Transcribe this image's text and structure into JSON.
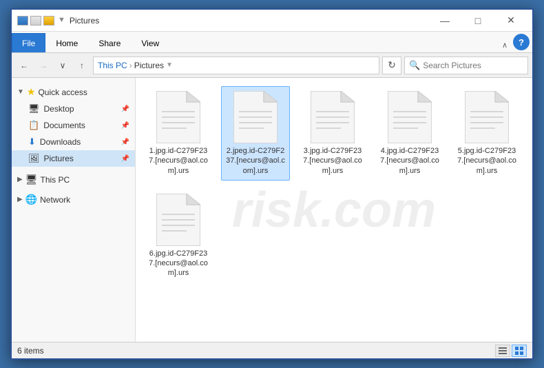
{
  "window": {
    "title": "Pictures",
    "icon_label": "folder-icon"
  },
  "ribbon": {
    "tabs": [
      "File",
      "Home",
      "Share",
      "View"
    ],
    "active_tab": "File",
    "expand_label": "∧",
    "help_label": "?"
  },
  "address_bar": {
    "back_label": "←",
    "forward_label": "→",
    "dropdown_label": "∨",
    "up_label": "↑",
    "breadcrumb": {
      "thispc": "This PC",
      "separator": "›",
      "current": "Pictures"
    },
    "refresh_label": "↻",
    "search_placeholder": "Search Pictures"
  },
  "sidebar": {
    "quick_access_label": "Quick access",
    "items": [
      {
        "id": "desktop",
        "label": "Desktop",
        "has_pin": true
      },
      {
        "id": "documents",
        "label": "Documents",
        "has_pin": true
      },
      {
        "id": "downloads",
        "label": "Downloads",
        "has_pin": true
      },
      {
        "id": "pictures",
        "label": "Pictures",
        "has_pin": true,
        "active": true
      }
    ],
    "this_pc_label": "This PC",
    "network_label": "Network"
  },
  "files": [
    {
      "id": "file1",
      "name": "1.jpg.id-C279F23\n7.[necurs@aol.co\nm].urs"
    },
    {
      "id": "file2",
      "name": "2.jpeg.id-C279F2\n37.[necurs@aol.c\nom].urs",
      "selected": true
    },
    {
      "id": "file3",
      "name": "3.jpg.id-C279F23\n7.[necurs@aol.co\nm].urs"
    },
    {
      "id": "file4",
      "name": "4.jpg.id-C279F23\n7.[necurs@aol.co\nm].urs"
    },
    {
      "id": "file5",
      "name": "5.jpg.id-C279F23\n7.[necurs@aol.co\nm].urs"
    },
    {
      "id": "file6",
      "name": "6.jpg.id-C279F23\n7.[necurs@aol.co\nm].urs"
    }
  ],
  "status_bar": {
    "item_count": "6 items"
  },
  "title_controls": {
    "minimize": "—",
    "maximize": "□",
    "close": "✕"
  }
}
